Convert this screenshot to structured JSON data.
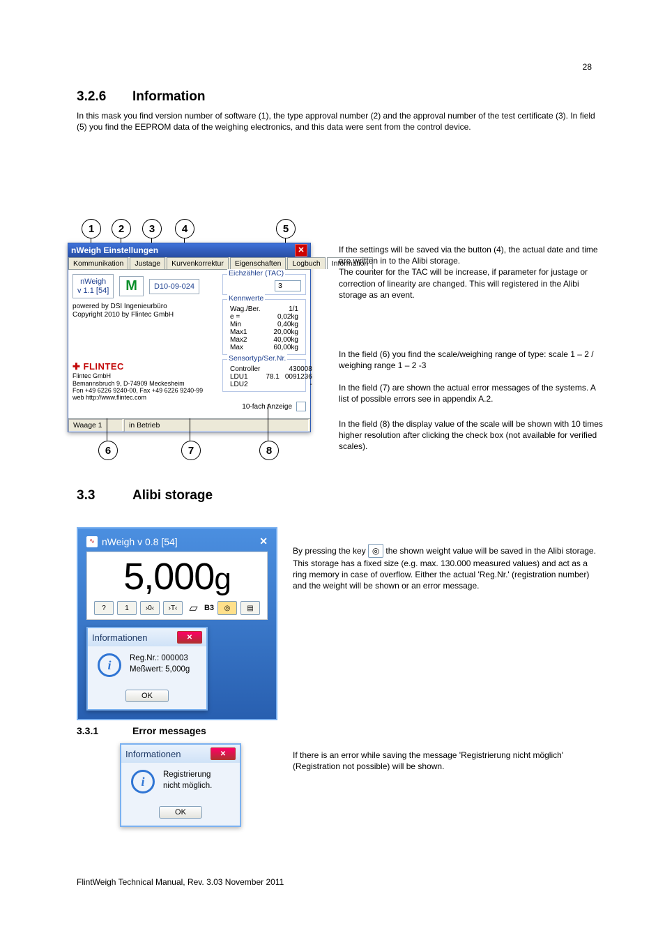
{
  "page_number_top": "28",
  "sect1": {
    "num": "3.2.6",
    "title": "Information"
  },
  "intro": "In this mask you find version number of software (1), the type approval number (2) and the approval number of the test certificate (3). In field (5) you find the EEPROM data of the weighing electronics, and this data were sent from the control device.",
  "dlg": {
    "title": "nWeigh Einstellungen",
    "tabs": [
      "Kommunikation",
      "Justage",
      "Kurvenkorrektur",
      "Eigenschaften",
      "Logbuch",
      "Information"
    ],
    "active_tab": 5,
    "version_label": "nWeigh",
    "version_val": "v 1.1 [54]",
    "mark": "M",
    "dcode": "D10-09-024",
    "powered": "powered by DSI Ingenieurbüro",
    "copyright": "Copyright 2010 by Flintec GmbH",
    "flintec": "FLINTEC",
    "addr1": "Flintec GmbH",
    "addr2": "Bemannsbruch 9, D-74909 Meckesheim",
    "addr3": "Fon +49 6226 9240-00, Fax +49 6226 9240-99",
    "addr4": "web http://www.flintec.com",
    "eich_legend": "Eichzähler (TAC)",
    "eich_val": "3",
    "kw_legend": "Kennwerte",
    "kw": [
      [
        "Wag./Ber.",
        "1/1"
      ],
      [
        "e =",
        "0,02kg"
      ],
      [
        "Min",
        "0,40kg"
      ],
      [
        "Max1",
        "20,00kg"
      ],
      [
        "Max2",
        "40,00kg"
      ],
      [
        "Max",
        "60,00kg"
      ]
    ],
    "sens_legend": "Sensortyp/Ser.Nr.",
    "sens": [
      [
        "Controller",
        "",
        "430008"
      ],
      [
        "LDU1",
        "78.1",
        "0091236"
      ],
      [
        "LDU2",
        "",
        "-"
      ]
    ],
    "x10_label": "10-fach Anzeige",
    "status_scale": "Waage 1",
    "status_state": "in Betrieb"
  },
  "after_dlg": "If the settings will be saved via the button (4), the actual date and time are written in to the Alibi storage.\nThe counter for the TAC will be increase, if parameter for justage or correction of linearity are changed. This will registered in the Alibi storage as an event.",
  "note6": "In the field (6) you find the scale/weighing range of type: scale 1 – 2 / weighing range 1 – 2 -3",
  "note7": "In the field (7) are shown the actual error messages of the systems. A list of possible errors see in appendix A.2.",
  "note8": "In the field (8) the display value of the scale will be shown with 10 times higher resolution after clicking the check box (not available for verified scales).",
  "sect2": {
    "num": "3.3",
    "title": "Alibi storage"
  },
  "alibi_text_pre": "By pressing the key ",
  "alibi_text_post": " the shown weight value will be saved in the Alibi storage. This storage has a fixed size (e.g. max. 130.000 measured values) and act as a ring memory in case of overflow. Either the actual 'Reg.Nr.' (registration number) and the weight will be shown or an error message.",
  "wpanel": {
    "title": "nWeigh v 0.8 [54]",
    "weight": "5,000",
    "unit": "g",
    "b3": "B3"
  },
  "info1": {
    "title": "Informationen",
    "line1": "Reg.Nr.: 000003",
    "line2": "Meßwert:  5,000g",
    "ok": "OK"
  },
  "sect3": {
    "num": "3.3.1",
    "title": "Error messages"
  },
  "err_text": "If there is an error while saving the message 'Registrierung nicht möglich' (Registration not possible) will be shown.",
  "info2": {
    "title": "Informationen",
    "line1": "Registrierung",
    "line2": "nicht möglich.",
    "ok": "OK"
  },
  "footer": "FlintWeigh Technical Manual, Rev. 3.03   November 2011"
}
